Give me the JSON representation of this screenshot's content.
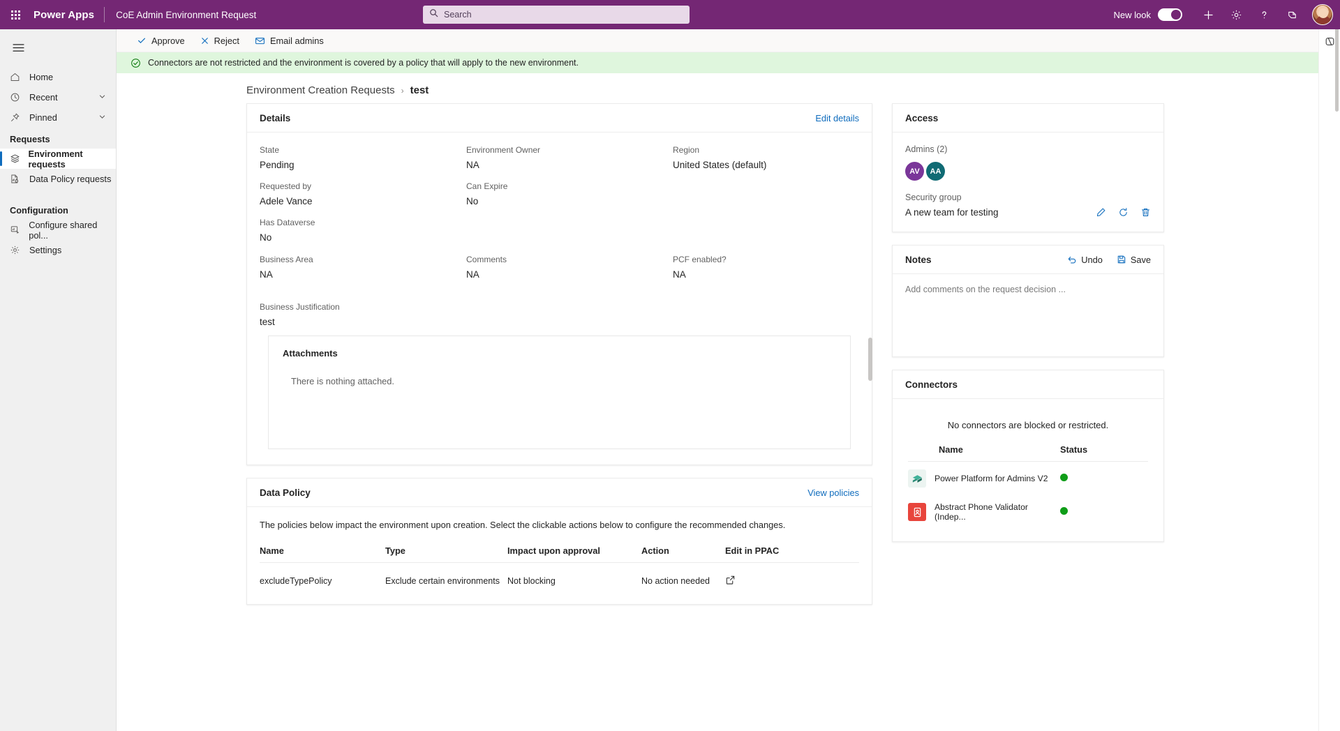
{
  "header": {
    "waffle_icon": "app-launcher-icon",
    "brand": "Power Apps",
    "app_name": "CoE Admin Environment Request",
    "search": {
      "placeholder": "Search",
      "value": "",
      "icon": "search-icon"
    },
    "new_look_label": "New look",
    "new_look_on": true,
    "icons": [
      "plus-icon",
      "gear-icon",
      "help-icon",
      "feedback-icon"
    ],
    "avatar": "user-avatar"
  },
  "sidebar": {
    "hamburger": "hamburger-icon",
    "items": [
      {
        "label": "Home",
        "icon": "home-icon",
        "chevron": false,
        "selected": false
      },
      {
        "label": "Recent",
        "icon": "clock-icon",
        "chevron": true,
        "selected": false
      },
      {
        "label": "Pinned",
        "icon": "pin-icon",
        "chevron": true,
        "selected": false
      }
    ],
    "groups": [
      {
        "title": "Requests",
        "items": [
          {
            "label": "Environment requests",
            "icon": "layers-icon",
            "selected": true
          },
          {
            "label": "Data Policy requests",
            "icon": "policy-report-icon",
            "selected": false
          }
        ]
      },
      {
        "title": "Configuration",
        "items": [
          {
            "label": "Configure shared pol...",
            "icon": "configure-icon",
            "selected": false
          },
          {
            "label": "Settings",
            "icon": "gear-icon",
            "selected": false
          }
        ]
      }
    ]
  },
  "commandbar": {
    "buttons": [
      {
        "label": "Approve",
        "icon": "checkmark-icon"
      },
      {
        "label": "Reject",
        "icon": "x-icon"
      },
      {
        "label": "Email admins",
        "icon": "mail-icon"
      }
    ]
  },
  "banner": {
    "icon": "success-check-icon",
    "text": "Connectors are not restricted and the environment is covered by a policy that will apply to the new environment.",
    "color": "#dff6dd"
  },
  "breadcrumb": {
    "parent": "Environment Creation Requests",
    "separator": "›",
    "current": "test"
  },
  "details": {
    "title": "Details",
    "edit_link": "Edit details",
    "rows": [
      [
        {
          "label": "State",
          "value": "Pending"
        },
        {
          "label": "Environment Owner",
          "value": "NA"
        },
        {
          "label": "Region",
          "value": "United States (default)"
        }
      ],
      [
        {
          "label": "Requested by",
          "value": "Adele Vance"
        },
        {
          "label": "Can Expire",
          "value": "No"
        },
        {
          "label": "",
          "value": ""
        }
      ],
      [
        {
          "label": "Has Dataverse",
          "value": "No"
        },
        {
          "label": "",
          "value": ""
        },
        {
          "label": "",
          "value": ""
        }
      ],
      [
        {
          "label": "Business Area",
          "value": "NA"
        },
        {
          "label": "Comments",
          "value": "NA"
        },
        {
          "label": "PCF enabled?",
          "value": "NA"
        }
      ],
      [
        {
          "label": "Business Justification",
          "value": "test"
        },
        {
          "label": "",
          "value": ""
        },
        {
          "label": "",
          "value": ""
        }
      ]
    ],
    "attachments": {
      "title": "Attachments",
      "empty_text": "There is nothing attached."
    }
  },
  "data_policy": {
    "title": "Data Policy",
    "view_link": "View policies",
    "description": "The policies below impact the environment upon creation. Select the clickable actions below to configure the recommended changes.",
    "columns": [
      "Name",
      "Type",
      "Impact upon approval",
      "Action",
      "Edit in PPAC"
    ],
    "rows": [
      {
        "name": "excludeTypePolicy",
        "type": "Exclude certain environments",
        "impact": "Not blocking",
        "action": "No action needed",
        "edit_icon": "open-in-new-icon"
      }
    ]
  },
  "access": {
    "title": "Access",
    "admins_label": "Admins (2)",
    "admins": [
      {
        "initials": "AV",
        "color": "#7a3699"
      },
      {
        "initials": "AA",
        "color": "#106b74"
      }
    ],
    "security_group_label": "Security group",
    "security_group_name": "A new team for testing",
    "actions": [
      {
        "icon": "pencil-icon",
        "name": "edit-security-group"
      },
      {
        "icon": "refresh-icon",
        "name": "refresh-security-group"
      },
      {
        "icon": "trash-icon",
        "name": "delete-security-group"
      }
    ]
  },
  "notes": {
    "title": "Notes",
    "undo_label": "Undo",
    "undo_icon": "undo-icon",
    "save_label": "Save",
    "save_icon": "save-icon",
    "placeholder": "Add comments on the request decision ...",
    "value": ""
  },
  "connectors": {
    "title": "Connectors",
    "none_text": "No connectors are blocked or restricted.",
    "columns": [
      "Name",
      "Status"
    ],
    "rows": [
      {
        "name": "Power Platform for Admins V2",
        "status_color": "#0f9d18",
        "icon_bg": "#f2f7f5",
        "icon": "power-platform-icon"
      },
      {
        "name": "Abstract Phone Validator (Indep...",
        "status_color": "#0f9d18",
        "icon_bg": "#e8453c",
        "icon": "phone-validator-icon"
      }
    ]
  },
  "rail": {
    "icons": [
      "copilot-icon"
    ]
  },
  "theme": {
    "brand_purple": "#742774",
    "accent_blue": "#0f6cbd",
    "success_green": "#107c10"
  }
}
